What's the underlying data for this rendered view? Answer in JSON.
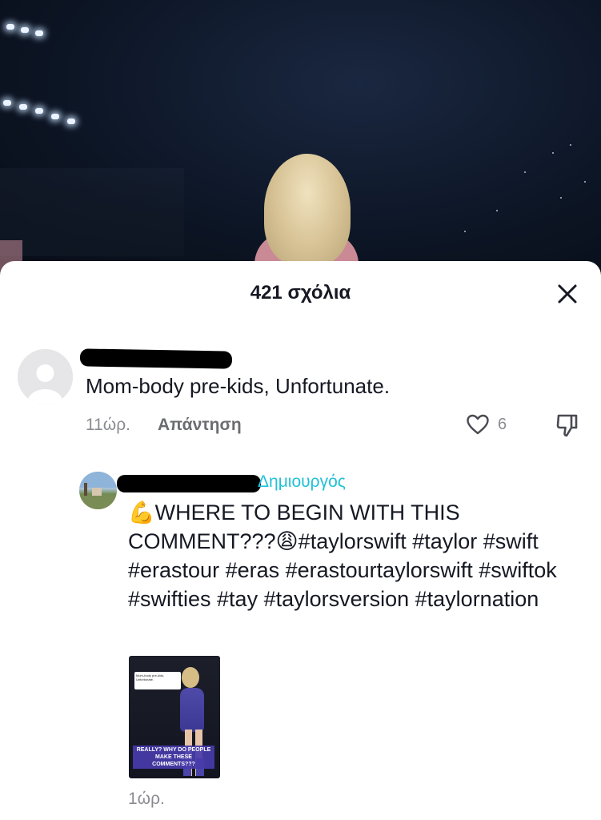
{
  "sheet": {
    "title": "421 σχόλια",
    "close_icon": "close-icon"
  },
  "comment": {
    "avatar_icon": "default-avatar-icon",
    "text": "Mom-body pre-kids, Unfortunate.",
    "time": "11ώρ.",
    "reply_label": "Απάντηση",
    "like_count": "6",
    "like_icon": "heart-outline-icon",
    "dislike_icon": "thumbs-down-icon"
  },
  "reply": {
    "creator_tag": "Δημιουργός",
    "text": "💪WHERE TO BEGIN WITH THIS COMMENT???😩#taylorswift #taylor #swift #erastour #eras #erastourtaylorswift #swiftok #swifties #tay #taylorsversion #taylornation",
    "thumbnail": {
      "sticker_text": "Mom-body pre-kids, Unfortunate.",
      "caption": "REALLY? WHY DO PEOPLE MAKE THESE COMMENTS???"
    },
    "time": "1ώρ."
  },
  "colors": {
    "accent_creator": "#20c1d8",
    "text_primary": "#161823",
    "text_secondary": "#8a8b91"
  }
}
